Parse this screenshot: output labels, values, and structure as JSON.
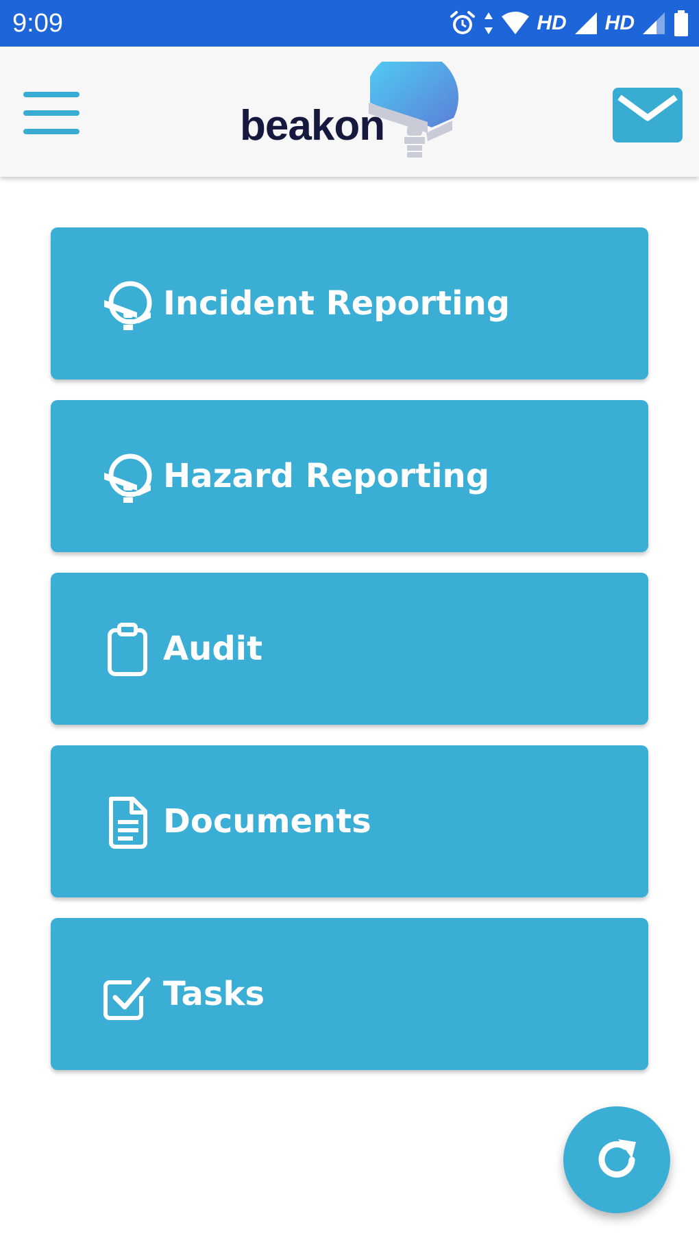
{
  "status_bar": {
    "time": "9:09",
    "network_label_1": "HD",
    "network_label_2": "HD"
  },
  "header": {
    "logo_text": "beakon",
    "menu_icon": "hamburger-menu-icon",
    "mail_icon": "mail-icon"
  },
  "menu": {
    "items": [
      {
        "label": "Incident Reporting",
        "icon": "beakon-lighthouse-icon"
      },
      {
        "label": "Hazard Reporting",
        "icon": "beakon-lighthouse-icon"
      },
      {
        "label": "Audit",
        "icon": "clipboard-icon"
      },
      {
        "label": "Documents",
        "icon": "document-icon"
      },
      {
        "label": "Tasks",
        "icon": "checkbox-icon"
      }
    ]
  },
  "fab": {
    "icon": "refresh-icon"
  },
  "colors": {
    "status_bar": "#1d65d8",
    "accent": "#3aaed4",
    "app_bar": "#f7f7f7",
    "logo_text": "#17183e"
  }
}
